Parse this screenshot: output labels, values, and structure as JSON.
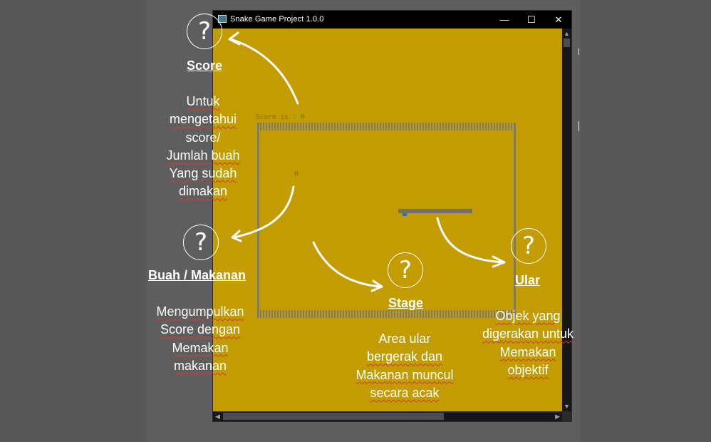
{
  "window": {
    "title": "Snake Game Project 1.0.0",
    "minimize_glyph": "—",
    "maximize_glyph": "☐",
    "close_glyph": "✕",
    "background_color": "#c29c00"
  },
  "game": {
    "score_text": "Score is : 0",
    "food_glyph": "0"
  },
  "annotations": {
    "score": {
      "icon": "question-circle-icon",
      "title": "Score",
      "lines": [
        "Untuk",
        "mengetahui",
        "score/",
        "Jumlah buah",
        "Yang sudah",
        "dimakan"
      ]
    },
    "food": {
      "icon": "question-circle-icon",
      "title": "Buah / Makanan",
      "lines": [
        "Mengumpulkan",
        "Score dengan",
        "Memakan",
        "makanan"
      ]
    },
    "stage": {
      "icon": "question-circle-icon",
      "title": "Stage",
      "lines": [
        "Area ular",
        "bergerak dan",
        "Makanan muncul",
        "secara acak"
      ]
    },
    "snake": {
      "icon": "question-circle-icon",
      "title": "Ular",
      "lines": [
        "Objek yang",
        "digerakan untuk",
        "Memakan",
        "objektif"
      ]
    }
  }
}
